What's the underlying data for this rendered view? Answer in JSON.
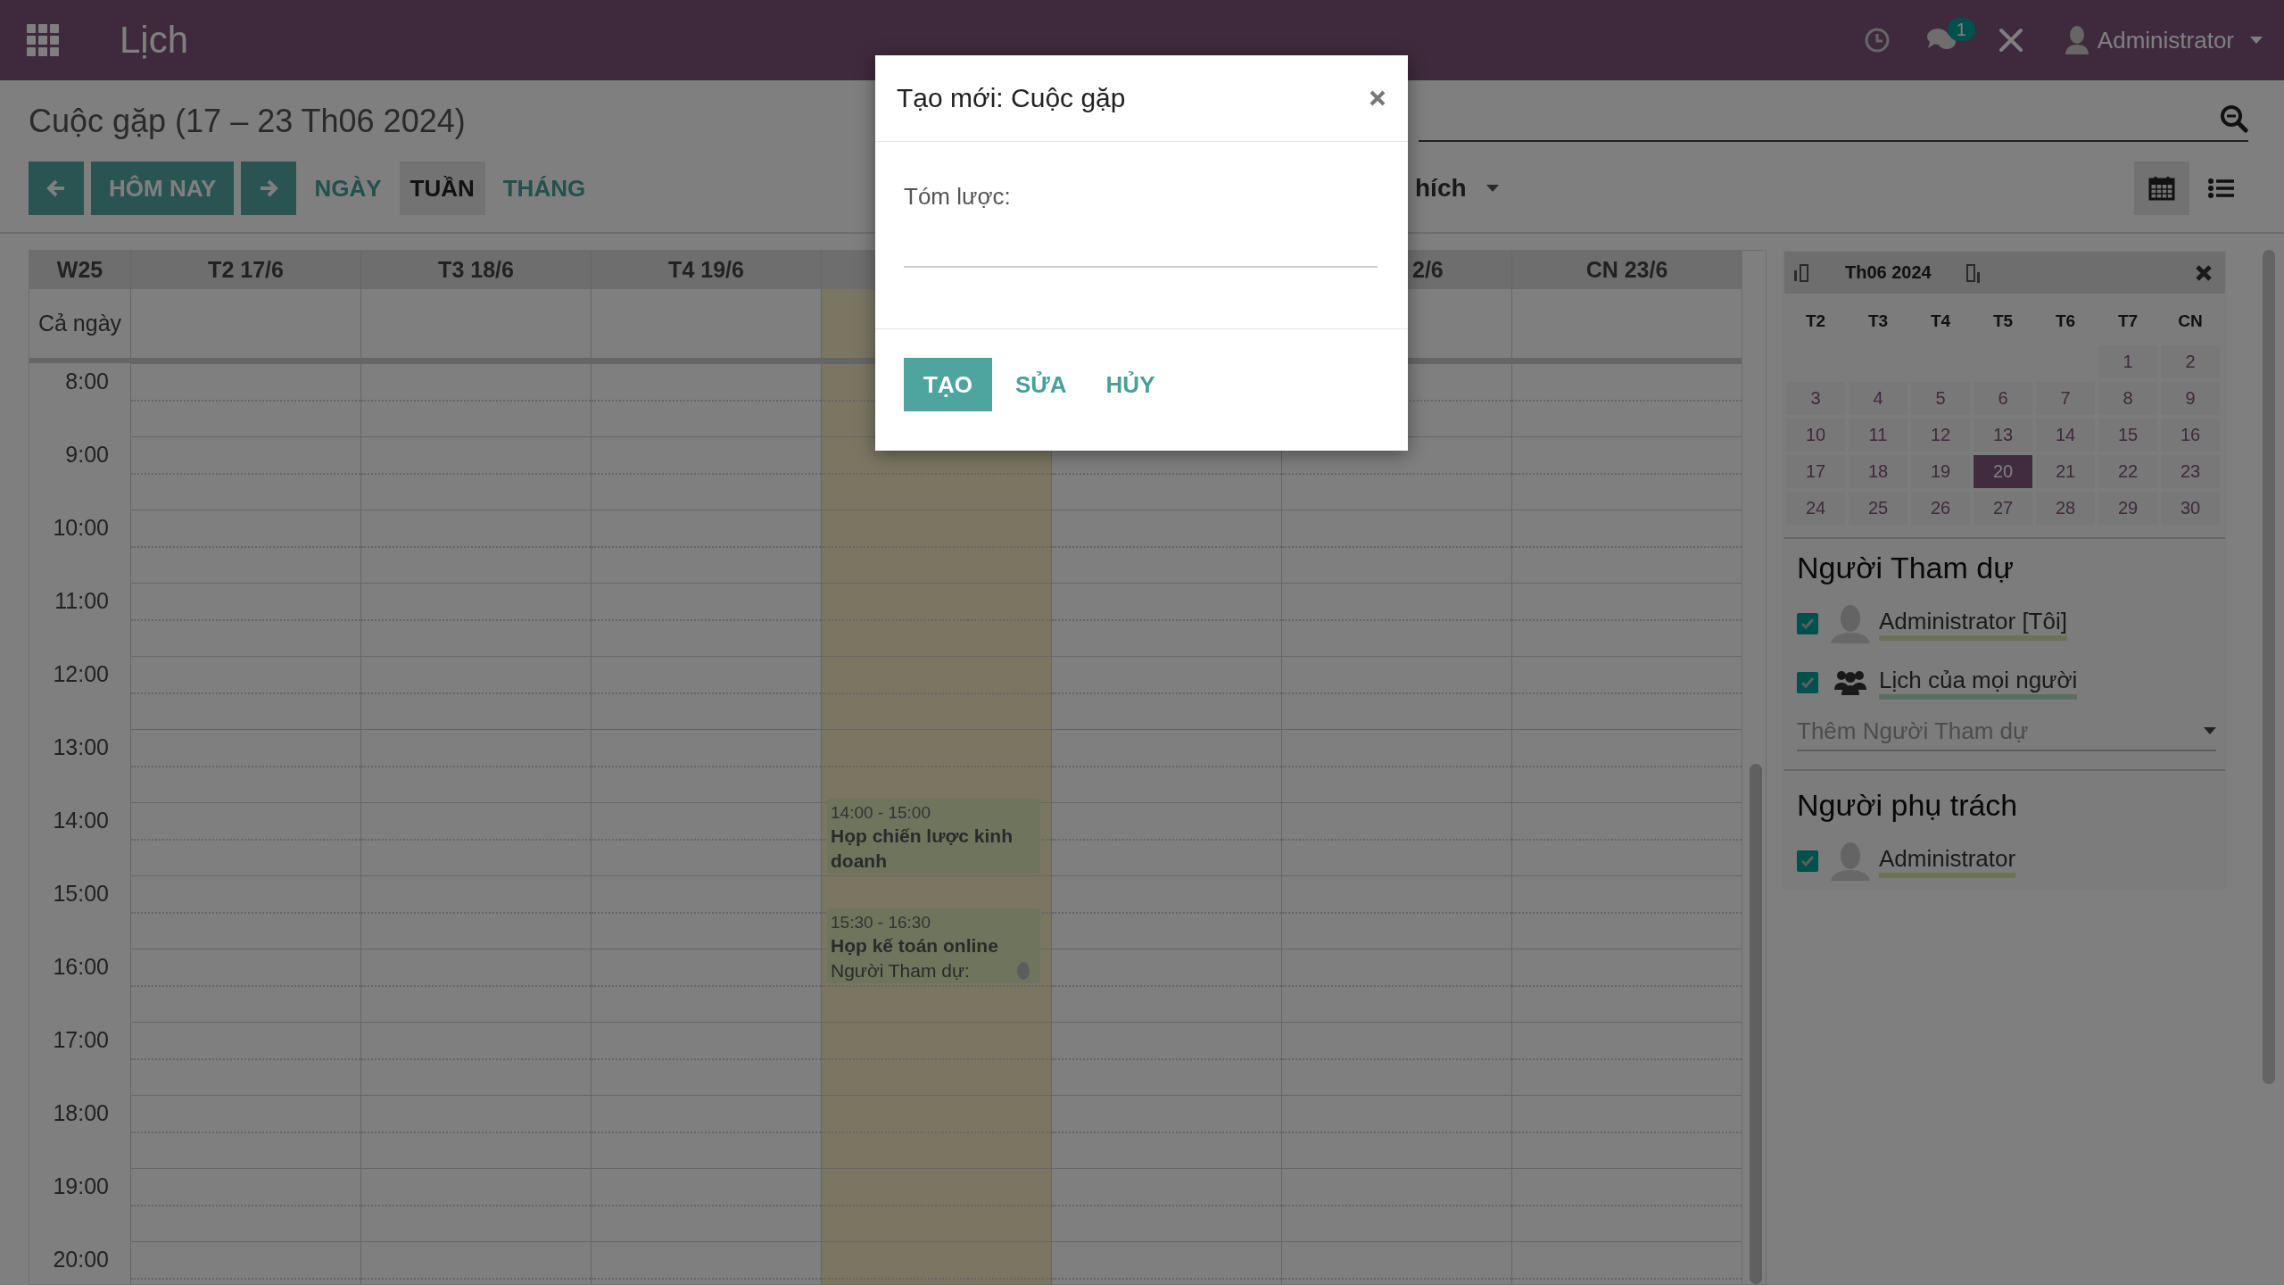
{
  "navbar": {
    "app_title": "Lịch",
    "chat_badge": "1",
    "user": "Administrator"
  },
  "control_panel": {
    "title": "Cuộc gặp (17 – 23 Th06 2024)",
    "today_label": "HÔM NAY",
    "scales": [
      {
        "label": "NGÀY",
        "selected": false
      },
      {
        "label": "TUẦN",
        "selected": true
      },
      {
        "label": "THÁNG",
        "selected": false
      }
    ],
    "filter_menu": "hích",
    "views": [
      {
        "kind": "calendar",
        "selected": true
      },
      {
        "kind": "list",
        "selected": false
      }
    ]
  },
  "calendar": {
    "week": "W25",
    "all_day_label": "Cả ngày",
    "days": [
      {
        "label": "T2 17/6",
        "today": false
      },
      {
        "label": "T3 18/6",
        "today": false
      },
      {
        "label": "T4 19/6",
        "today": false
      },
      {
        "today": true,
        "events": [
          {
            "time": "14:00 - 15:00",
            "title": "Họp chiến lược kinh doanh"
          },
          {
            "time": "15:30 - 16:30",
            "title": "Họp kế toán online",
            "attendees_label": "Người Tham dự:"
          }
        ]
      },
      {
        "today": false
      },
      {
        "label": "2/6",
        "today": false
      },
      {
        "label": "CN 23/6",
        "today": false
      }
    ],
    "hours": [
      "8:00",
      "9:00",
      "10:00",
      "11:00",
      "12:00",
      "13:00",
      "14:00",
      "15:00",
      "16:00",
      "17:00",
      "18:00",
      "19:00",
      "20:00"
    ]
  },
  "mini_calendar": {
    "title": "Th06 2024",
    "weekdays": [
      "T2",
      "T3",
      "T4",
      "T5",
      "T6",
      "T7",
      "CN"
    ],
    "weeks": [
      [
        {
          "label": "1",
          "selected": false
        },
        {
          "label": "2",
          "selected": false
        }
      ],
      [
        {
          "label": "3",
          "selected": false
        },
        {
          "label": "4",
          "selected": false
        },
        {
          "label": "5",
          "selected": false
        },
        {
          "label": "6",
          "selected": false
        },
        {
          "label": "7",
          "selected": false
        },
        {
          "label": "8",
          "selected": false
        },
        {
          "label": "9",
          "selected": false
        }
      ],
      [
        {
          "label": "10",
          "selected": false
        },
        {
          "label": "11",
          "selected": false
        },
        {
          "label": "12",
          "selected": false
        },
        {
          "label": "13",
          "selected": false
        },
        {
          "label": "14",
          "selected": false
        },
        {
          "label": "15",
          "selected": false
        },
        {
          "label": "16",
          "selected": false
        }
      ],
      [
        {
          "label": "17",
          "selected": false
        },
        {
          "label": "18",
          "selected": false
        },
        {
          "label": "19",
          "selected": false
        },
        {
          "label": "20",
          "selected": true
        },
        {
          "label": "21",
          "selected": false
        },
        {
          "label": "22",
          "selected": false
        },
        {
          "label": "23",
          "selected": false
        }
      ],
      [
        {
          "label": "24",
          "selected": false
        },
        {
          "label": "25",
          "selected": false
        },
        {
          "label": "26",
          "selected": false
        },
        {
          "label": "27",
          "selected": false
        },
        {
          "label": "28",
          "selected": false
        },
        {
          "label": "29",
          "selected": false
        },
        {
          "label": "30",
          "selected": false
        }
      ]
    ]
  },
  "filters": [
    {
      "title": "Người Tham dự",
      "items": [
        {
          "kind": "user",
          "label": "Administrator [Tôi]",
          "checked": true,
          "color": "#6b7354"
        },
        {
          "kind": "group",
          "label": "Lịch của mọi người",
          "checked": true,
          "color": "#5a6e62"
        }
      ],
      "add_placeholder": "Thêm Người Tham dự"
    },
    {
      "title": "Người phụ trách",
      "items": [
        {
          "kind": "user",
          "label": "Administrator",
          "checked": true,
          "color": "#6b7354"
        }
      ]
    }
  ],
  "dialog": {
    "title": "Tạo mới: Cuộc gặp",
    "field_label": "Tóm lược:",
    "buttons": [
      {
        "label": "TẠO",
        "kind": "primary"
      },
      {
        "label": "SỬA",
        "kind": "secondary"
      },
      {
        "label": "HỦY",
        "kind": "secondary"
      }
    ]
  }
}
